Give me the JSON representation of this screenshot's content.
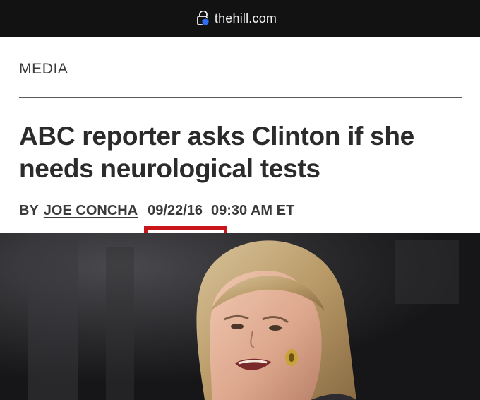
{
  "browser": {
    "url": "thehill.com",
    "icons": {
      "site_security": "lock-shield-icon"
    },
    "bar_color": "#121212"
  },
  "article": {
    "section": "MEDIA",
    "headline": "ABC reporter asks Clinton if she needs neurological tests",
    "byline": {
      "prefix": "BY",
      "author": "JOE CONCHA",
      "date": "09/22/16",
      "time": "09:30 AM ET"
    },
    "highlight_color": "#c9161b"
  },
  "hero_image": {
    "subject": "woman-speaking-photo"
  }
}
